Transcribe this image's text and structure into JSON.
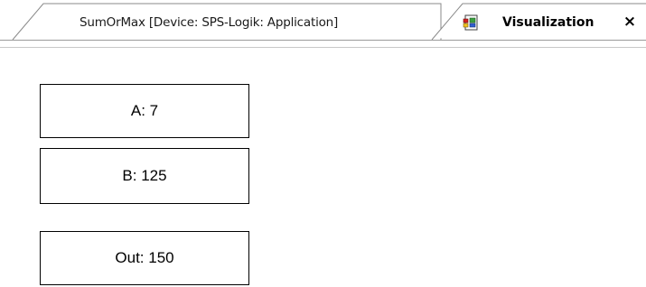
{
  "tabs": [
    {
      "label": "SumOrMax [Device: SPS-Logik: Application]",
      "active": false
    },
    {
      "label": "Visualization",
      "active": true,
      "icon": "visualization-icon"
    }
  ],
  "close_icon": "×",
  "visualization": {
    "a_text": "A: 7",
    "b_text": "B: 125",
    "out_text": "Out: 150"
  }
}
